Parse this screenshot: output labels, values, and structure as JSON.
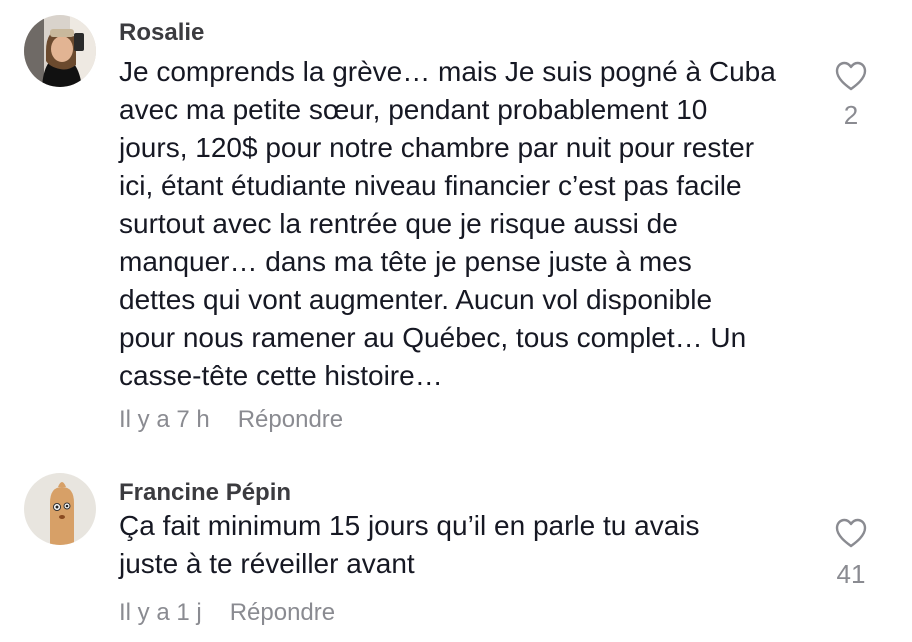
{
  "comments": [
    {
      "username": "Rosalie",
      "text": "Je comprends la grève… mais Je suis pogné à Cuba\navec ma petite sœur, pendant probablement 10\njours, 120$ pour notre chambre par nuit pour rester\nici, étant étudiante niveau financier c’est pas facile\nsurtout avec la rentrée que je risque aussi de\nmanquer… dans ma tête je pense juste à mes\ndettes qui vont augmenter. Aucun vol disponible\npour nous ramener au Québec, tous complet… Un\ncasse-tête cette histoire…",
      "time": "Il y a 7 h",
      "reply_label": "Répondre",
      "likes": "2",
      "like_icon": "heart-outline-icon"
    },
    {
      "username": "Francine Pépin",
      "text": "Ça fait minimum 15 jours qu’il en parle tu avais\njuste à te réveiller avant",
      "time": "Il y a 1 j",
      "reply_label": "Répondre",
      "likes": "41",
      "like_icon": "heart-outline-icon"
    }
  ],
  "colors": {
    "text": "#161823",
    "username": "#3b3b3f",
    "secondary": "#8a8b91",
    "background": "#ffffff"
  }
}
